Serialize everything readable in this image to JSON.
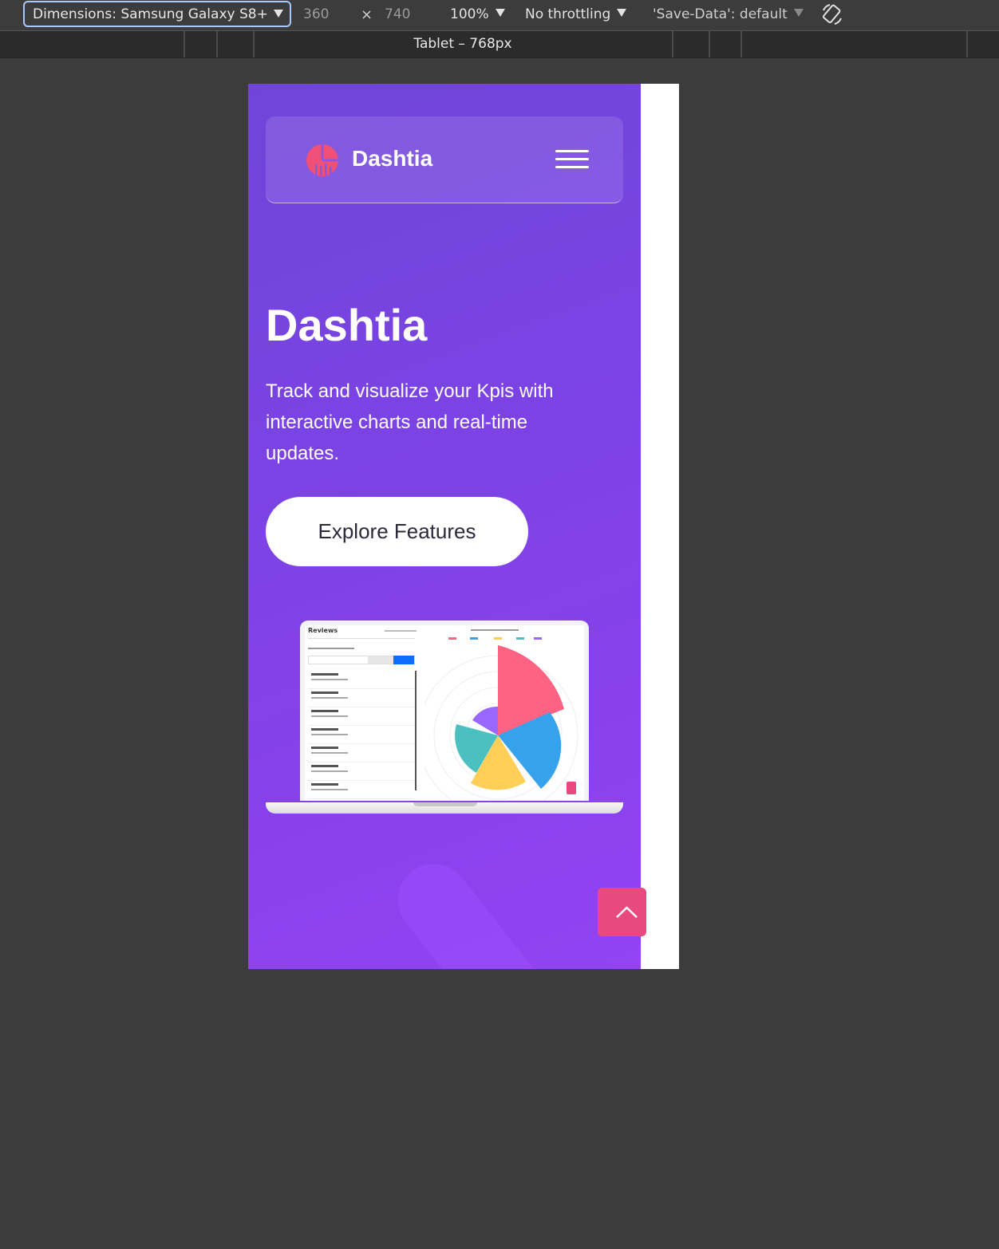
{
  "devtools": {
    "device_label": "Dimensions: Samsung Galaxy S8+",
    "width": "360",
    "height": "740",
    "zoom": "100%",
    "throttling": "No throttling",
    "save_data": "'Save-Data': default",
    "breakpoint_label": "Tablet – 768px"
  },
  "nav": {
    "brand": "Dashtia",
    "menu_icon": "hamburger-icon",
    "logo_icon": "pie-logo-icon"
  },
  "hero": {
    "title": "Dashtia",
    "subtitle": "Track and visualize your Kpis with interactive charts and real-time updates.",
    "cta_label": "Explore Features"
  },
  "mockup": {
    "title": "Reviews"
  },
  "scroll_top": {
    "icon": "chevron-up-icon"
  },
  "colors": {
    "hero_start": "#6f45d8",
    "hero_end": "#9343f2",
    "accent_pink": "#e84a80",
    "logo_pink": "#f04f78"
  }
}
